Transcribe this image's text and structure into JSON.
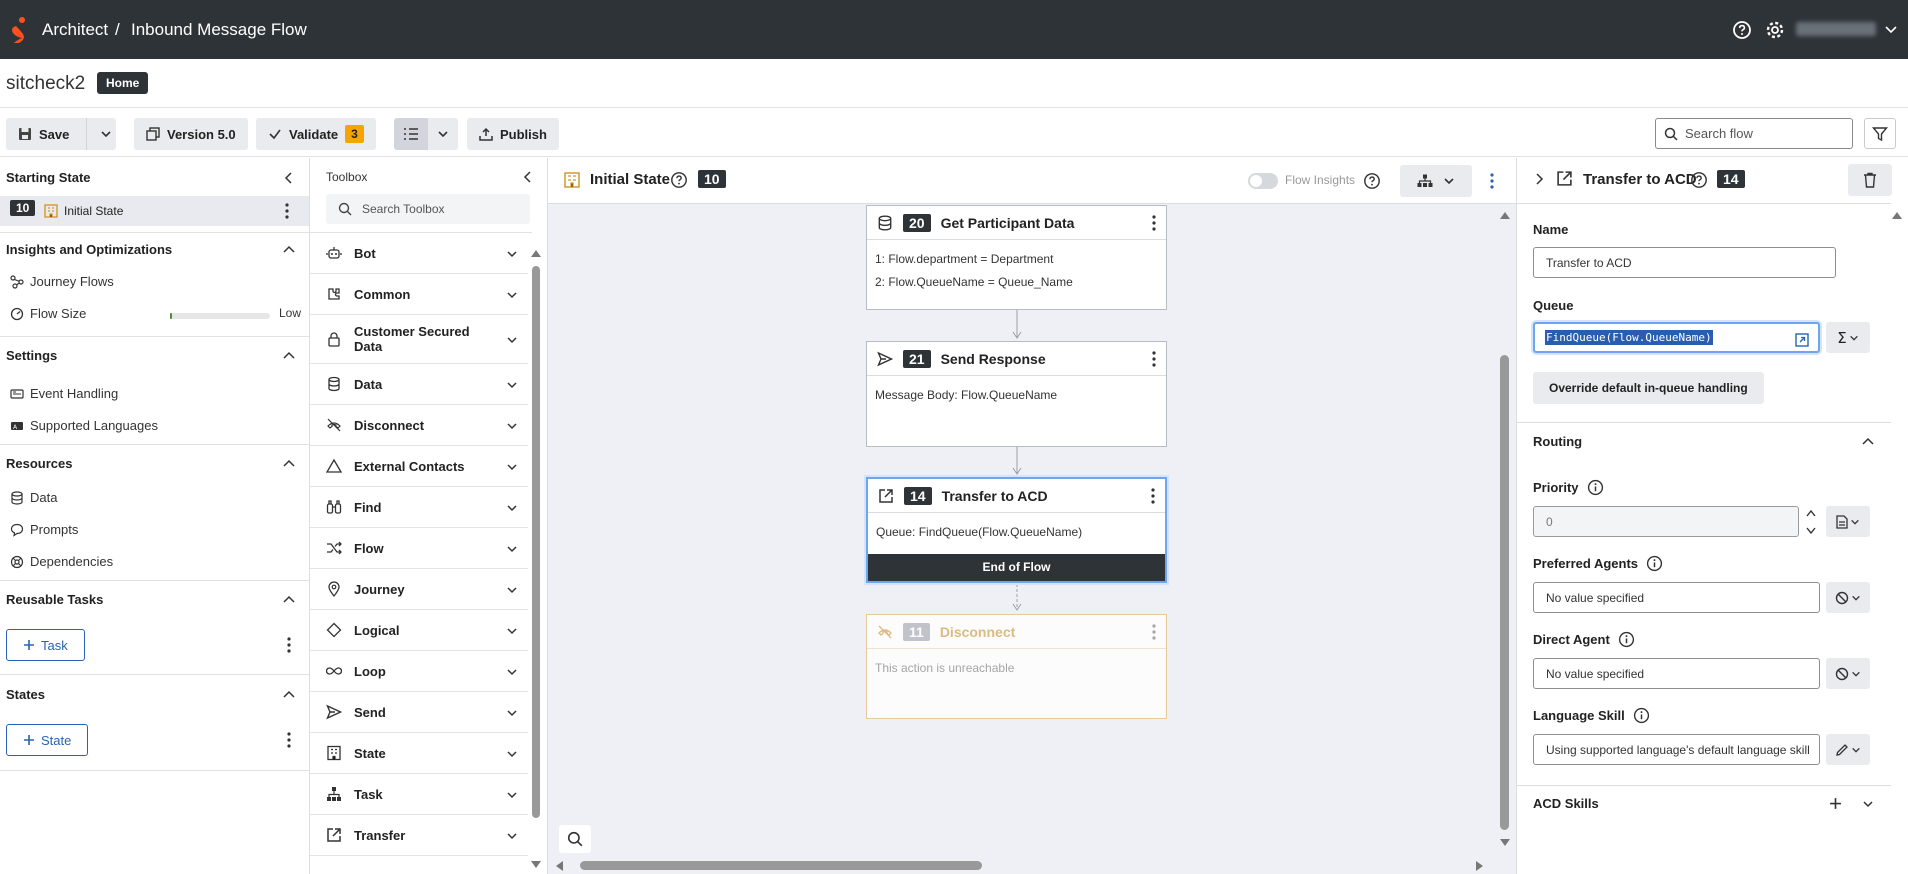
{
  "app": {
    "name": "Architect",
    "separator": "/",
    "page": "Inbound Message Flow"
  },
  "flow": {
    "name": "sitcheck2",
    "badge": "Home"
  },
  "toolbar": {
    "save": "Save",
    "version": "Version 5.0",
    "validate": "Validate",
    "validate_count": "3",
    "publish": "Publish",
    "search_placeholder": "Search flow"
  },
  "left": {
    "starting_state": "Starting State",
    "initial_num": "10",
    "initial_label": "Initial State",
    "insights": "Insights and Optimizations",
    "journey_flows": "Journey Flows",
    "flow_size": "Flow Size",
    "flow_size_value": "Low",
    "flow_size_level": 0.02,
    "settings": "Settings",
    "event_handling": "Event Handling",
    "supported_languages": "Supported Languages",
    "resources": "Resources",
    "data": "Data",
    "prompts": "Prompts",
    "dependencies": "Dependencies",
    "reusable_tasks": "Reusable Tasks",
    "task_btn": "Task",
    "states": "States",
    "state_btn": "State"
  },
  "toolbox": {
    "title": "Toolbox",
    "search_placeholder": "Search Toolbox",
    "items": [
      "Bot",
      "Common",
      "Customer Secured Data",
      "Data",
      "Disconnect",
      "External Contacts",
      "Find",
      "Flow",
      "Journey",
      "Logical",
      "Loop",
      "Send",
      "State",
      "Task",
      "Transfer"
    ]
  },
  "canvas": {
    "state_title": "Initial State",
    "state_num": "10",
    "insights_toggle": "Flow Insights",
    "cards": {
      "participant": {
        "num": "20",
        "title": "Get Participant Data",
        "lines": [
          "1: Flow.department = Department",
          "2: Flow.QueueName = Queue_Name"
        ]
      },
      "send": {
        "num": "21",
        "title": "Send Response",
        "lines": [
          "Message Body: Flow.QueueName"
        ]
      },
      "transfer": {
        "num": "14",
        "title": "Transfer to ACD",
        "lines": [
          "Queue: FindQueue(Flow.QueueName)"
        ],
        "footer": "End of Flow"
      },
      "disconnect": {
        "num": "11",
        "title": "Disconnect",
        "lines": [
          "This action is unreachable"
        ]
      }
    }
  },
  "right": {
    "title": "Transfer to ACD",
    "num": "14",
    "name_label": "Name",
    "name_value": "Transfer to ACD",
    "queue_label": "Queue",
    "queue_value": "FindQueue(Flow.QueueName)",
    "override_btn": "Override default in-queue handling",
    "routing": "Routing",
    "priority_label": "Priority",
    "priority_value": "0",
    "preferred_agents_label": "Preferred Agents",
    "preferred_agents_value": "No value specified",
    "direct_agent_label": "Direct Agent",
    "direct_agent_value": "No value specified",
    "language_skill_label": "Language Skill",
    "language_skill_value": "Using supported language's default language skill",
    "acd_skills": "ACD Skills"
  },
  "colors": {
    "topbar": "#2e3338",
    "accent": "#2a62b5",
    "warning": "#f6a500",
    "logo": "#ff4f1f",
    "unreachable": "#d9b26b"
  }
}
